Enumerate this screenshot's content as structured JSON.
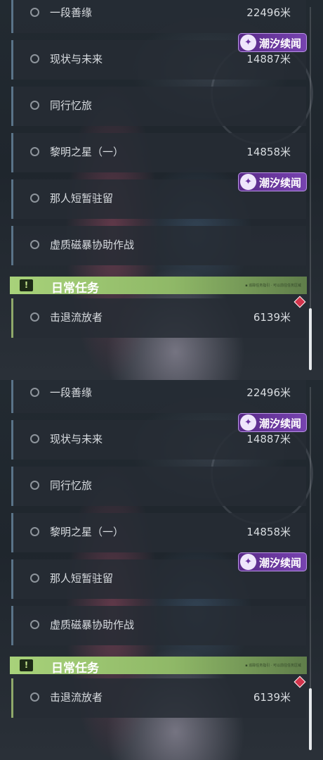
{
  "panels": [
    {
      "quests": [
        {
          "name": "一段善缘",
          "distance": "22496米"
        },
        {
          "name": "现状与未来",
          "distance": "14887米"
        },
        {
          "name": "同行忆旅",
          "distance": ""
        },
        {
          "name": "黎明之星（一）",
          "distance": "14858米"
        },
        {
          "name": "那人短暂驻留",
          "distance": ""
        },
        {
          "name": "虚质磁暴协助作战",
          "distance": ""
        }
      ],
      "badges": [
        {
          "icon": "✦",
          "label": "潮汐续闻"
        },
        {
          "icon": "✦",
          "label": "潮汐续闻"
        }
      ],
      "daily_section": {
        "icon": "!",
        "title": "日常任务",
        "tag": "▪ 追踪任务指引 · 可以前往任务区域"
      },
      "daily_quest": {
        "name": "击退流放者",
        "distance": "6139米"
      },
      "scroll_position": 0.82
    },
    {
      "quests": [
        {
          "name": "一段善缘",
          "distance": "22496米"
        },
        {
          "name": "现状与未来",
          "distance": "14887米"
        },
        {
          "name": "同行忆旅",
          "distance": ""
        },
        {
          "name": "黎明之星（一）",
          "distance": "14858米"
        },
        {
          "name": "那人短暂驻留",
          "distance": ""
        },
        {
          "name": "虚质磁暴协助作战",
          "distance": ""
        }
      ],
      "badges": [
        {
          "icon": "✦",
          "label": "潮汐续闻"
        },
        {
          "icon": "✦",
          "label": "潮汐续闻"
        }
      ],
      "daily_section": {
        "icon": "!",
        "title": "日常任务",
        "tag": "▪ 追踪任务指引 · 可以前往任务区域"
      },
      "daily_quest": {
        "name": "击退流放者",
        "distance": "6139米"
      },
      "scroll_position": 0.82
    }
  ],
  "colors": {
    "badge_purple": "#6a33a0",
    "daily_green": "#a8d27a",
    "tracked_marker_red": "#d2334b"
  }
}
